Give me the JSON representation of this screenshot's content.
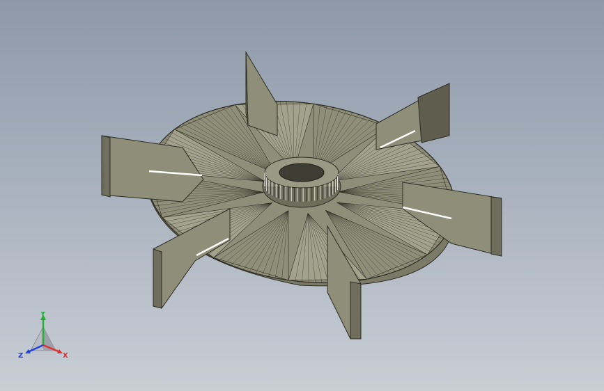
{
  "colors": {
    "background_top": "#8e99a8",
    "background_bottom": "#c9ced5",
    "part_face": "#8f8e78",
    "part_face_light": "#a3a28c",
    "part_face_dark": "#6f6e5c",
    "edge": "#2b2b22",
    "axis_x": "#e03030",
    "axis_y": "#20b030",
    "axis_z": "#2040e0"
  },
  "triad": {
    "x_label": "X",
    "y_label": "Y",
    "z_label": "Z"
  },
  "model": {
    "blade_count": 6,
    "segment_count": 12,
    "icon": "fan-impeller-icon"
  }
}
